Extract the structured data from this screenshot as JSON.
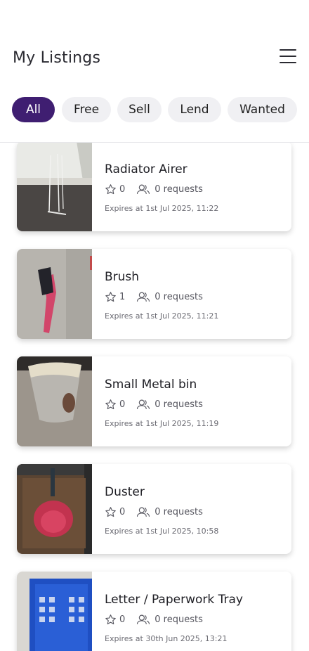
{
  "header": {
    "title": "My Listings",
    "menu_icon": "hamburger-menu-icon"
  },
  "filters": [
    {
      "label": "All",
      "active": true
    },
    {
      "label": "Free",
      "active": false
    },
    {
      "label": "Sell",
      "active": false
    },
    {
      "label": "Lend",
      "active": false
    },
    {
      "label": "Wanted",
      "active": false
    }
  ],
  "colors": {
    "accent": "#3f1e71",
    "chip_bg": "#f0f0f3"
  },
  "listings": [
    {
      "title": "Radiator Airer",
      "stars": "0",
      "requests": "0 requests",
      "expires": "Expires at  1st Jul 2025, 11:22"
    },
    {
      "title": "Brush",
      "stars": "1",
      "requests": "0 requests",
      "expires": "Expires at  1st Jul 2025, 11:21"
    },
    {
      "title": "Small Metal bin",
      "stars": "0",
      "requests": "0 requests",
      "expires": "Expires at  1st Jul 2025, 11:19"
    },
    {
      "title": "Duster",
      "stars": "0",
      "requests": "0 requests",
      "expires": "Expires at  1st Jul 2025, 10:58"
    },
    {
      "title": "Letter / Paperwork Tray",
      "stars": "0",
      "requests": "0 requests",
      "expires": "Expires at  30th Jun 2025, 13:21"
    }
  ]
}
